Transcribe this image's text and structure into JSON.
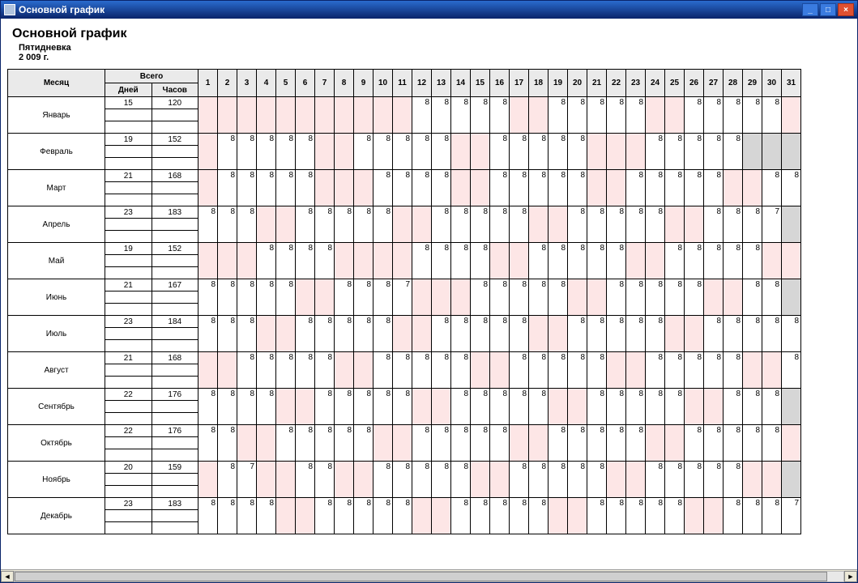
{
  "window": {
    "title": "Основной график"
  },
  "header": {
    "title": "Основной график",
    "sub1": "Пятидневка",
    "sub2": "2 009 г."
  },
  "columns": {
    "month": "Месяц",
    "total": "Всего",
    "days_label": "Дней",
    "hours_label": "Часов"
  },
  "day_numbers": [
    "1",
    "2",
    "3",
    "4",
    "5",
    "6",
    "7",
    "8",
    "9",
    "10",
    "11",
    "12",
    "13",
    "14",
    "15",
    "16",
    "17",
    "18",
    "19",
    "20",
    "21",
    "22",
    "23",
    "24",
    "25",
    "26",
    "27",
    "28",
    "29",
    "30",
    "31"
  ],
  "months": [
    {
      "name": "Январь",
      "days": 15,
      "hours": 120,
      "cells": [
        "p",
        "p",
        "p",
        "p",
        "p",
        "p",
        "p",
        "p",
        "p",
        "p",
        "p",
        "8",
        "8",
        "8",
        "8",
        "8",
        "p",
        "p",
        "8",
        "8",
        "8",
        "8",
        "8",
        "p",
        "p",
        "8",
        "8",
        "8",
        "8",
        "8",
        "p"
      ]
    },
    {
      "name": "Февраль",
      "days": 19,
      "hours": 152,
      "cells": [
        "p",
        "8",
        "8",
        "8",
        "8",
        "8",
        "p",
        "p",
        "8",
        "8",
        "8",
        "8",
        "8",
        "p",
        "p",
        "8",
        "8",
        "8",
        "8",
        "8",
        "p",
        "p",
        "p",
        "8",
        "8",
        "8",
        "8",
        "8",
        "g",
        "g",
        "g"
      ]
    },
    {
      "name": "Март",
      "days": 21,
      "hours": 168,
      "cells": [
        "p",
        "8",
        "8",
        "8",
        "8",
        "8",
        "p",
        "p",
        "p",
        "8",
        "8",
        "8",
        "8",
        "p",
        "p",
        "8",
        "8",
        "8",
        "8",
        "8",
        "p",
        "p",
        "8",
        "8",
        "8",
        "8",
        "8",
        "p",
        "p",
        "8",
        "8"
      ]
    },
    {
      "name": "Апрель",
      "days": 23,
      "hours": 183,
      "cells": [
        "8",
        "8",
        "8",
        "p",
        "p",
        "8",
        "8",
        "8",
        "8",
        "8",
        "p",
        "p",
        "8",
        "8",
        "8",
        "8",
        "8",
        "p",
        "p",
        "8",
        "8",
        "8",
        "8",
        "8",
        "p",
        "p",
        "8",
        "8",
        "8",
        "7",
        "g"
      ]
    },
    {
      "name": "Май",
      "days": 19,
      "hours": 152,
      "cells": [
        "p",
        "p",
        "p",
        "8",
        "8",
        "8",
        "8",
        "p",
        "p",
        "p",
        "p",
        "8",
        "8",
        "8",
        "8",
        "p",
        "p",
        "8",
        "8",
        "8",
        "8",
        "8",
        "p",
        "p",
        "8",
        "8",
        "8",
        "8",
        "8",
        "p",
        "p"
      ]
    },
    {
      "name": "Июнь",
      "days": 21,
      "hours": 167,
      "cells": [
        "8",
        "8",
        "8",
        "8",
        "8",
        "p",
        "p",
        "8",
        "8",
        "8",
        "7",
        "p",
        "p",
        "p",
        "8",
        "8",
        "8",
        "8",
        "8",
        "p",
        "p",
        "8",
        "8",
        "8",
        "8",
        "8",
        "p",
        "p",
        "8",
        "8",
        "g"
      ]
    },
    {
      "name": "Июль",
      "days": 23,
      "hours": 184,
      "cells": [
        "8",
        "8",
        "8",
        "p",
        "p",
        "8",
        "8",
        "8",
        "8",
        "8",
        "p",
        "p",
        "8",
        "8",
        "8",
        "8",
        "8",
        "p",
        "p",
        "8",
        "8",
        "8",
        "8",
        "8",
        "p",
        "p",
        "8",
        "8",
        "8",
        "8",
        "8"
      ]
    },
    {
      "name": "Август",
      "days": 21,
      "hours": 168,
      "cells": [
        "p",
        "p",
        "8",
        "8",
        "8",
        "8",
        "8",
        "p",
        "p",
        "8",
        "8",
        "8",
        "8",
        "8",
        "p",
        "p",
        "8",
        "8",
        "8",
        "8",
        "8",
        "p",
        "p",
        "8",
        "8",
        "8",
        "8",
        "8",
        "p",
        "p",
        "8"
      ]
    },
    {
      "name": "Сентябрь",
      "days": 22,
      "hours": 176,
      "cells": [
        "8",
        "8",
        "8",
        "8",
        "p",
        "p",
        "8",
        "8",
        "8",
        "8",
        "8",
        "p",
        "p",
        "8",
        "8",
        "8",
        "8",
        "8",
        "p",
        "p",
        "8",
        "8",
        "8",
        "8",
        "8",
        "p",
        "p",
        "8",
        "8",
        "8",
        "g"
      ]
    },
    {
      "name": "Октябрь",
      "days": 22,
      "hours": 176,
      "cells": [
        "8",
        "8",
        "p",
        "p",
        "8",
        "8",
        "8",
        "8",
        "8",
        "p",
        "p",
        "8",
        "8",
        "8",
        "8",
        "8",
        "p",
        "p",
        "8",
        "8",
        "8",
        "8",
        "8",
        "p",
        "p",
        "8",
        "8",
        "8",
        "8",
        "8",
        "p"
      ]
    },
    {
      "name": "Ноябрь",
      "days": 20,
      "hours": 159,
      "cells": [
        "p",
        "8",
        "7",
        "p",
        "p",
        "8",
        "8",
        "p",
        "p",
        "8",
        "8",
        "8",
        "8",
        "8",
        "p",
        "p",
        "8",
        "8",
        "8",
        "8",
        "8",
        "p",
        "p",
        "8",
        "8",
        "8",
        "8",
        "8",
        "p",
        "p",
        "g"
      ]
    },
    {
      "name": "Декабрь",
      "days": 23,
      "hours": 183,
      "cells": [
        "8",
        "8",
        "8",
        "8",
        "p",
        "p",
        "8",
        "8",
        "8",
        "8",
        "8",
        "p",
        "p",
        "8",
        "8",
        "8",
        "8",
        "8",
        "p",
        "p",
        "8",
        "8",
        "8",
        "8",
        "8",
        "p",
        "p",
        "8",
        "8",
        "8",
        "7"
      ]
    }
  ]
}
